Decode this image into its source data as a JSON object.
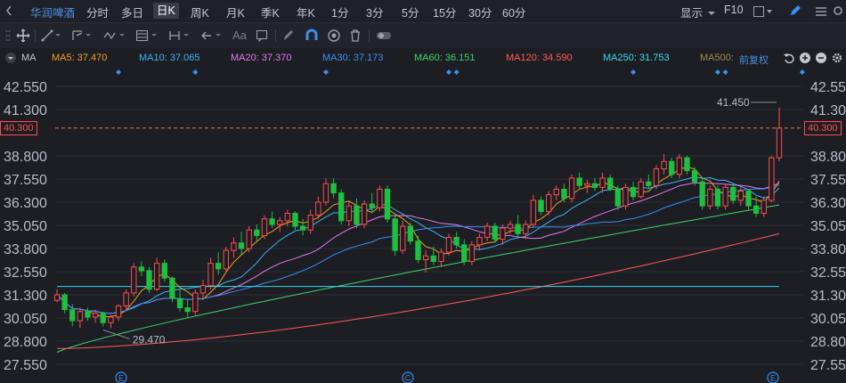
{
  "topbar": {
    "stock_name": "华润啤酒",
    "periods": [
      "分时",
      "多日",
      "日K",
      "周K",
      "月K",
      "季K",
      "年K",
      "1分",
      "3分",
      "5分",
      "15分",
      "30分",
      "60分"
    ],
    "active_period": "日K",
    "right": {
      "display_label": "显示",
      "f10_label": "F10"
    }
  },
  "toolbar": {
    "icons": [
      "crosshair-icon",
      "line-tool-icon",
      "channel-tool-icon",
      "wave-tool-icon",
      "fibonacci-tool-icon",
      "range-tool-icon",
      "arrow-tool-icon",
      "text-tool-icon",
      "note-tool-icon",
      "pen-icon",
      "magnet-icon",
      "eye-icon",
      "trash-icon",
      "toggle-icon"
    ],
    "text_tool_label": "Aa"
  },
  "ma_bar": {
    "indicator": "MA",
    "items": [
      {
        "label": "MA5: 37.470",
        "color": "#f0a020"
      },
      {
        "label": "MA10: 37.065",
        "color": "#3ab4f2"
      },
      {
        "label": "MA20: 37.370",
        "color": "#e07ce8"
      },
      {
        "label": "MA30: 37.173",
        "color": "#3a8ff2"
      },
      {
        "label": "MA60: 36.151",
        "color": "#3ed26e"
      },
      {
        "label": "MA120: 34.590",
        "color": "#ff5a5a"
      },
      {
        "label": "MA250: 31.753",
        "color": "#3ad8e8"
      },
      {
        "label": "MA500:",
        "color": "#a08a4a"
      }
    ],
    "adjust_label": "前复权"
  },
  "chart_data": {
    "type": "candlestick",
    "y_ticks": [
      "42.550",
      "41.300",
      "40.300",
      "38.800",
      "37.550",
      "36.300",
      "35.050",
      "33.800",
      "32.550",
      "31.300",
      "30.050",
      "28.800",
      "27.550"
    ],
    "ylim": [
      27.55,
      42.55
    ],
    "current_price": "40.300",
    "annotations": {
      "high": "41.450",
      "low": "29.470"
    },
    "event_markers": [
      "E",
      "C",
      "E"
    ],
    "candles": [
      [
        31.0,
        31.6,
        30.9,
        31.3
      ],
      [
        31.3,
        31.4,
        30.3,
        30.5
      ],
      [
        30.5,
        30.8,
        29.6,
        29.9
      ],
      [
        29.9,
        30.6,
        29.5,
        30.4
      ],
      [
        30.4,
        30.6,
        29.9,
        30.1
      ],
      [
        30.1,
        30.5,
        29.8,
        30.3
      ],
      [
        30.3,
        30.4,
        29.6,
        29.8
      ],
      [
        29.8,
        30.2,
        29.5,
        30.1
      ],
      [
        30.1,
        30.8,
        29.9,
        30.7
      ],
      [
        30.7,
        31.6,
        30.5,
        31.4
      ],
      [
        31.4,
        33.0,
        31.2,
        32.8
      ],
      [
        32.8,
        33.1,
        32.3,
        32.6
      ],
      [
        32.6,
        32.8,
        31.4,
        31.6
      ],
      [
        31.6,
        33.3,
        31.5,
        33.0
      ],
      [
        33.0,
        33.2,
        32.0,
        32.2
      ],
      [
        32.2,
        32.3,
        30.9,
        31.1
      ],
      [
        31.1,
        31.6,
        30.4,
        30.6
      ],
      [
        30.6,
        31.0,
        30.0,
        30.4
      ],
      [
        30.4,
        31.6,
        30.2,
        31.4
      ],
      [
        31.4,
        32.1,
        31.1,
        31.8
      ],
      [
        31.8,
        33.3,
        31.6,
        33.0
      ],
      [
        33.0,
        33.6,
        32.4,
        32.7
      ],
      [
        32.7,
        33.9,
        32.5,
        33.7
      ],
      [
        33.7,
        34.4,
        33.3,
        34.1
      ],
      [
        34.1,
        34.7,
        33.5,
        33.8
      ],
      [
        33.8,
        35.0,
        33.6,
        34.8
      ],
      [
        34.8,
        35.1,
        34.2,
        34.5
      ],
      [
        34.5,
        35.6,
        34.3,
        35.4
      ],
      [
        35.4,
        35.8,
        34.9,
        35.1
      ],
      [
        35.1,
        35.5,
        34.7,
        35.3
      ],
      [
        35.3,
        35.9,
        35.0,
        35.7
      ],
      [
        35.7,
        35.8,
        34.8,
        35.0
      ],
      [
        35.0,
        35.4,
        34.5,
        34.8
      ],
      [
        34.8,
        35.9,
        34.6,
        35.6
      ],
      [
        35.6,
        36.6,
        35.4,
        36.3
      ],
      [
        36.3,
        37.6,
        36.1,
        37.3
      ],
      [
        37.3,
        37.6,
        36.5,
        36.8
      ],
      [
        36.8,
        37.0,
        35.1,
        35.3
      ],
      [
        35.3,
        36.4,
        35.0,
        36.1
      ],
      [
        36.1,
        36.5,
        34.9,
        35.1
      ],
      [
        35.1,
        36.4,
        34.9,
        36.2
      ],
      [
        36.2,
        36.8,
        35.7,
        36.0
      ],
      [
        36.0,
        37.2,
        35.8,
        37.0
      ],
      [
        37.0,
        37.2,
        35.2,
        35.4
      ],
      [
        35.4,
        35.6,
        33.4,
        33.7
      ],
      [
        33.7,
        35.3,
        33.5,
        35.0
      ],
      [
        35.0,
        35.2,
        34.0,
        34.2
      ],
      [
        34.2,
        34.5,
        33.0,
        33.2
      ],
      [
        33.2,
        33.7,
        32.5,
        33.4
      ],
      [
        33.4,
        33.9,
        32.9,
        33.1
      ],
      [
        33.1,
        33.8,
        32.8,
        33.6
      ],
      [
        33.6,
        34.6,
        33.4,
        34.4
      ],
      [
        34.4,
        34.7,
        33.8,
        34.0
      ],
      [
        34.0,
        34.3,
        32.9,
        33.1
      ],
      [
        33.1,
        34.2,
        32.9,
        34.0
      ],
      [
        34.0,
        34.6,
        33.7,
        34.4
      ],
      [
        34.4,
        35.2,
        34.2,
        35.0
      ],
      [
        35.0,
        35.2,
        34.1,
        34.3
      ],
      [
        34.3,
        35.1,
        34.0,
        34.9
      ],
      [
        34.9,
        35.3,
        34.6,
        35.1
      ],
      [
        35.1,
        35.6,
        34.4,
        34.6
      ],
      [
        34.6,
        35.3,
        34.3,
        35.1
      ],
      [
        35.1,
        36.7,
        34.9,
        36.4
      ],
      [
        36.4,
        36.6,
        35.6,
        35.8
      ],
      [
        35.8,
        36.9,
        35.6,
        36.7
      ],
      [
        36.7,
        37.2,
        36.4,
        37.0
      ],
      [
        37.0,
        37.3,
        36.3,
        36.5
      ],
      [
        36.5,
        37.8,
        36.3,
        37.6
      ],
      [
        37.6,
        37.9,
        37.0,
        37.2
      ],
      [
        37.2,
        37.5,
        36.8,
        37.3
      ],
      [
        37.3,
        37.6,
        36.9,
        37.1
      ],
      [
        37.1,
        37.9,
        36.8,
        37.6
      ],
      [
        37.6,
        37.8,
        36.9,
        37.0
      ],
      [
        37.0,
        37.2,
        35.9,
        36.1
      ],
      [
        36.1,
        37.3,
        35.9,
        37.1
      ],
      [
        37.1,
        37.4,
        36.4,
        36.6
      ],
      [
        36.6,
        37.6,
        36.5,
        37.4
      ],
      [
        37.4,
        37.8,
        37.0,
        37.2
      ],
      [
        37.2,
        38.3,
        37.0,
        38.1
      ],
      [
        38.1,
        38.9,
        37.8,
        38.5
      ],
      [
        38.5,
        38.7,
        37.6,
        37.8
      ],
      [
        37.8,
        38.9,
        37.6,
        38.7
      ],
      [
        38.7,
        38.8,
        37.8,
        38.0
      ],
      [
        38.0,
        38.2,
        37.2,
        37.4
      ],
      [
        37.4,
        37.6,
        35.9,
        36.1
      ],
      [
        36.1,
        37.2,
        35.9,
        37.0
      ],
      [
        37.0,
        37.2,
        35.9,
        36.1
      ],
      [
        36.1,
        37.3,
        35.9,
        37.1
      ],
      [
        37.1,
        37.3,
        36.2,
        36.4
      ],
      [
        36.4,
        37.1,
        36.1,
        36.9
      ],
      [
        36.9,
        37.0,
        35.9,
        36.1
      ],
      [
        36.1,
        36.6,
        35.5,
        35.7
      ],
      [
        35.7,
        36.6,
        35.5,
        36.4
      ],
      [
        36.4,
        38.8,
        36.3,
        38.7
      ],
      [
        38.7,
        41.4,
        38.5,
        40.3
      ]
    ]
  }
}
